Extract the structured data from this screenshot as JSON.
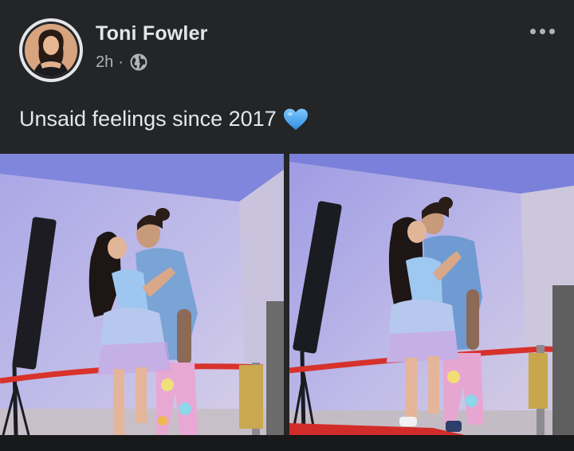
{
  "post": {
    "author": "Toni Fowler",
    "timestamp": "2h",
    "separator": "·",
    "privacy_icon": "globe-icon",
    "caption": "Unsaid feelings since 2017",
    "caption_emoji": "blue-heart-icon",
    "more_icon": "more-options-icon"
  },
  "photos": [
    {
      "description_name": "photo-1"
    },
    {
      "description_name": "photo-2"
    }
  ],
  "colors": {
    "background": "#242526",
    "text_primary": "#e4e6eb",
    "text_secondary": "#b0b3b8",
    "heart": "#4fb0f5"
  }
}
